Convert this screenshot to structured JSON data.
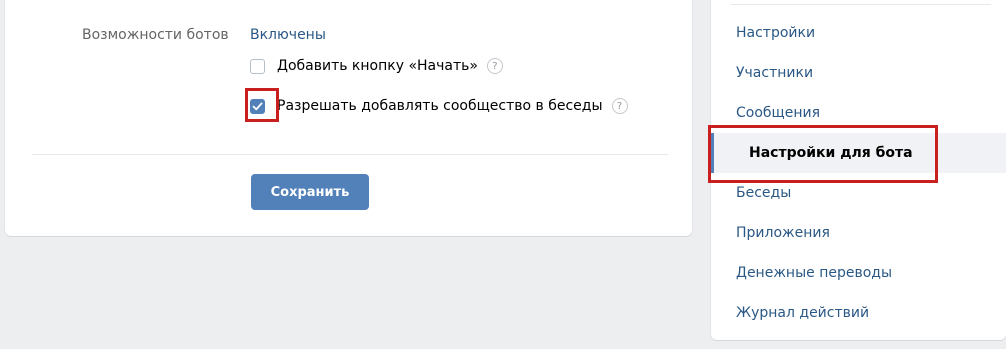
{
  "settings": {
    "bot_capabilities_label": "Возможности ботов",
    "bot_capabilities_value": "Включены",
    "options": [
      {
        "label": "Добавить кнопку «Начать»",
        "checked": false,
        "help": "?"
      },
      {
        "label": "Разрешать добавлять сообщество в беседы",
        "checked": true,
        "help": "?"
      }
    ],
    "save_label": "Сохранить"
  },
  "menu": {
    "items": [
      {
        "label": "Настройки"
      },
      {
        "label": "Участники"
      },
      {
        "label": "Сообщения"
      },
      {
        "label": "Настройки для бота",
        "active": true
      },
      {
        "label": "Беседы"
      },
      {
        "label": "Приложения"
      },
      {
        "label": "Денежные переводы"
      },
      {
        "label": "Журнал действий"
      }
    ]
  },
  "colors": {
    "accent": "#5181b8",
    "link": "#2a5885",
    "highlight": "#c81f1f",
    "background": "#edeef0"
  }
}
